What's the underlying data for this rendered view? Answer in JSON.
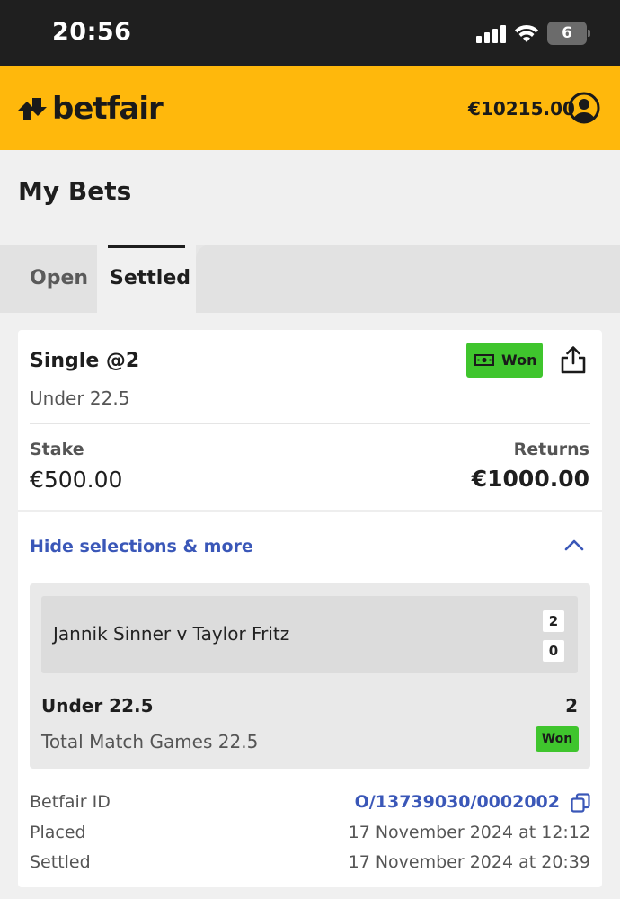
{
  "status_bar": {
    "time": "20:56",
    "battery": "6"
  },
  "header": {
    "brand": "betfair",
    "balance": "€10215.00"
  },
  "page": {
    "title": "My Bets"
  },
  "tabs": [
    {
      "label": "Open",
      "active": false
    },
    {
      "label": "Settled",
      "active": true
    }
  ],
  "bet": {
    "type": "Single @2",
    "status": "Won",
    "selection_summary": "Under 22.5",
    "stake_label": "Stake",
    "stake_value": "€500.00",
    "returns_label": "Returns",
    "returns_value": "€1000.00",
    "toggle_label": "Hide selections & more",
    "event": {
      "name": "Jannik Sinner v Taylor Fritz",
      "scores": [
        "2",
        "0"
      ]
    },
    "selection": {
      "name": "Under 22.5",
      "odds": "2",
      "market": "Total Match Games 22.5",
      "result": "Won"
    },
    "details": [
      {
        "label": "Betfair ID",
        "value": "O/13739030/0002002"
      },
      {
        "label": "Placed",
        "value": "17 November 2024 at 12:12"
      },
      {
        "label": "Settled",
        "value": "17 November 2024 at 20:39"
      }
    ]
  },
  "colors": {
    "brand_yellow": "#ffb80c",
    "won_green": "#3fc52d",
    "link_blue": "#3a57b8"
  }
}
